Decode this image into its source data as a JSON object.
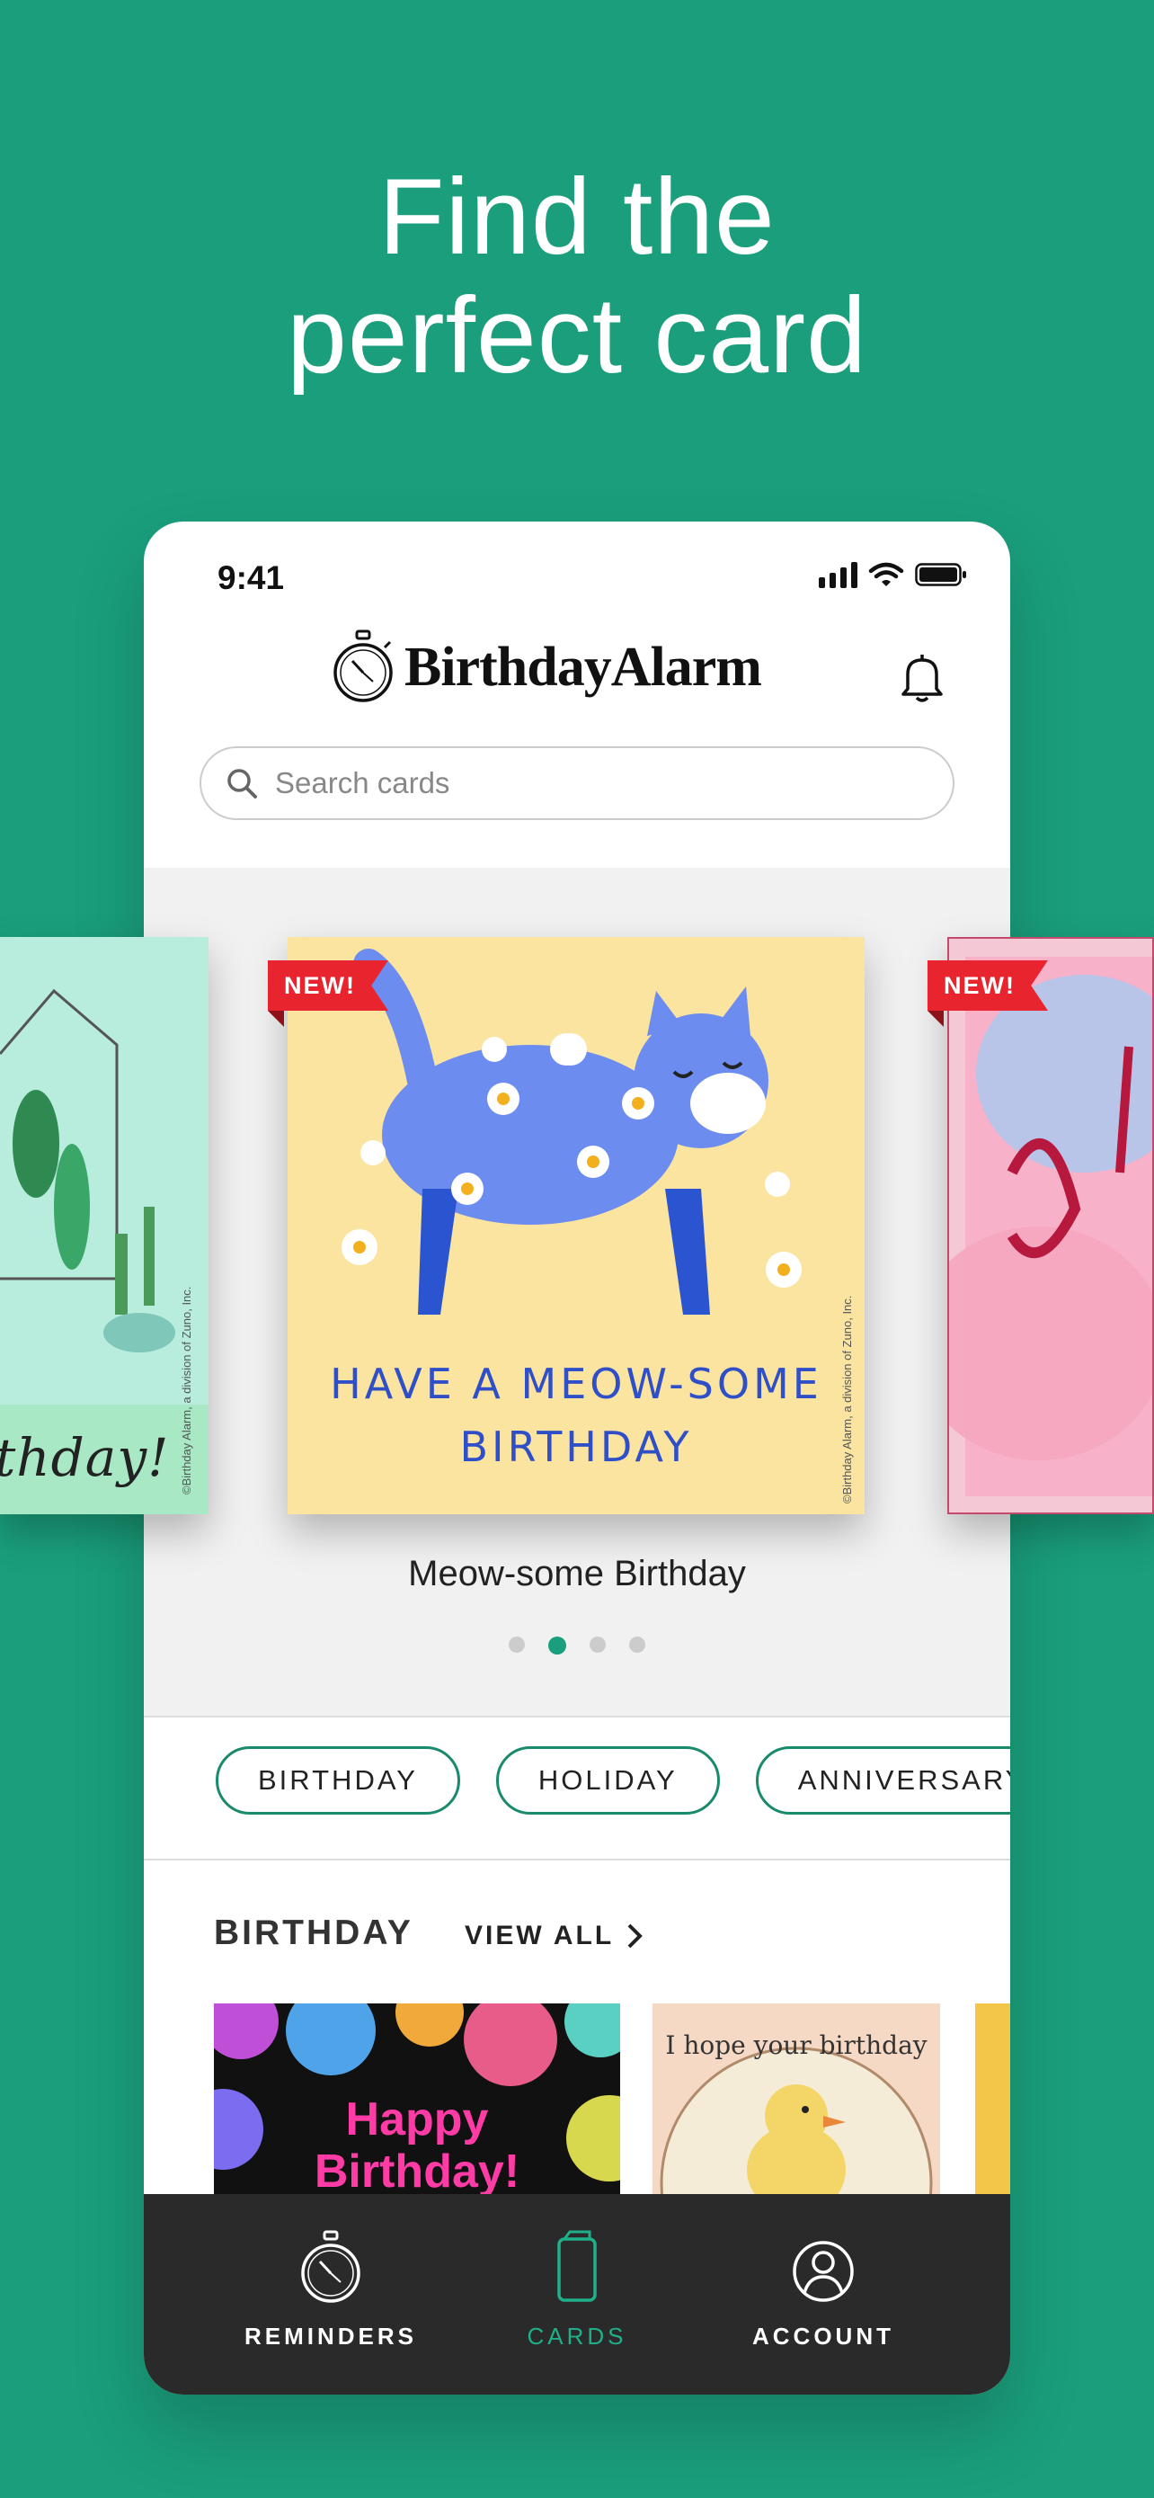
{
  "headline": {
    "line1": "Find the",
    "line2": "perfect card"
  },
  "status_bar": {
    "time": "9:41"
  },
  "header": {
    "logo_text": "BirthdayAlarm"
  },
  "search": {
    "placeholder": "Search cards"
  },
  "carousel": {
    "badge": "NEW!",
    "left_card_text": "thday!",
    "main_card_text_line1": "HAVE A MEOW-SOME",
    "main_card_text_line2": "BIRTHDAY",
    "copyright": "©Birthday Alarm, a division of Zuno, Inc.",
    "caption": "Meow-some Birthday",
    "page_count": 4,
    "active_page": 2
  },
  "chips": [
    "BIRTHDAY",
    "HOLIDAY",
    "ANNIVERSARY"
  ],
  "section": {
    "title": "BIRTHDAY",
    "view_all": "VIEW ALL"
  },
  "thumbnails": {
    "card1_line1": "Happy",
    "card1_line2": "Birthday!",
    "card2_text": "I hope your birthday"
  },
  "tabbar": {
    "items": [
      {
        "label": "REMINDERS",
        "icon": "stopwatch-icon"
      },
      {
        "label": "CARDS",
        "icon": "card-icon",
        "active": true
      },
      {
        "label": "ACCOUNT",
        "icon": "user-icon"
      }
    ]
  },
  "colors": {
    "brand_green": "#1a9e7b",
    "badge_red": "#e8242e",
    "tabbar_bg": "#2a2a2a"
  }
}
